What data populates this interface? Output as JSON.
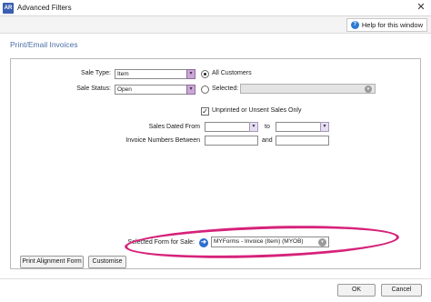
{
  "window": {
    "app_icon_text": "AR",
    "title": "Advanced Filters",
    "close_glyph": "✕"
  },
  "help": {
    "label": "Help for this window",
    "icon": "help-icon"
  },
  "section_title": "Print/Email Invoices",
  "filters": {
    "sale_type_label": "Sale Type:",
    "sale_type_value": "Item",
    "sale_status_label": "Sale Status:",
    "sale_status_value": "Open",
    "all_customers_label": "All Customers",
    "all_customers_selected": true,
    "selected_label": "Selected:",
    "selected_value": "",
    "unprinted_label": "Unprinted or Unsent Sales Only",
    "unprinted_checked": true,
    "sales_dated_from_label": "Sales Dated From",
    "to_label": "to",
    "invoice_numbers_label": "Invoice Numbers Between",
    "and_label": "and"
  },
  "form": {
    "label": "Selected Form for Sale:",
    "value": "MYForms - Invoice (Item) (MYOB)"
  },
  "buttons": {
    "print_alignment": "Print Alignment Form",
    "customise": "Customise",
    "ok": "OK",
    "cancel": "Cancel"
  },
  "colors": {
    "highlight": "#d6227a",
    "section_title": "#4a6fa5",
    "dropdown_accent": "#c9a9d3"
  }
}
